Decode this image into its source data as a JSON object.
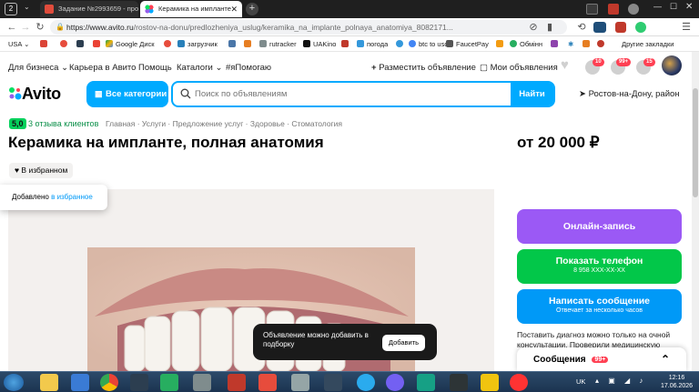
{
  "browser": {
    "tab_counter": "2",
    "tabs": [
      {
        "label": "Задание №2993659 - про",
        "active": false
      },
      {
        "label": "Керамика на импланте",
        "active": true
      }
    ],
    "url_host": "https://www.avito.ru",
    "url_path": "/rostov-na-donu/predlozheniya_uslug/keramika_na_implante_polnaya_anatomiya_8082171...",
    "bookmarks": [
      "USA",
      "Google Диск",
      "загрузчик",
      "rutracker",
      "UAKino",
      "погода",
      "btc to usd",
      "FaucetPay",
      "Обмінн"
    ],
    "other_bookmarks": "Другие закладки"
  },
  "topnav": {
    "business": "Для бизнеса",
    "career": "Карьера в Авито",
    "help": "Помощь",
    "catalogs": "Каталоги",
    "hashtag": "#яПомогаю",
    "post_ad": "Разместить объявление",
    "my_ads": "Мои объявления",
    "badges": [
      "10",
      "99+",
      "15"
    ]
  },
  "header": {
    "logo": "Avito",
    "all_categories": "Все категории",
    "search_placeholder": "Поиск по объявлениям",
    "find": "Найти",
    "location": "Ростов-на-Дону, район"
  },
  "listing": {
    "rating_value": "5,0",
    "rating_label": "3 отзыва клиентов",
    "breadcrumbs": [
      "Главная",
      "Услуги",
      "Предложение услуг",
      "Здоровье",
      "Стоматология"
    ],
    "title": "Керамика на импланте, полная анатомия",
    "price": "от 20 000 ₽",
    "favorite_button": "В избранном"
  },
  "toast_favorites": {
    "text": "Добавлено",
    "link": "в избранное"
  },
  "actions": {
    "online_booking": "Онлайн-запись",
    "show_phone": "Показать телефон",
    "phone_masked": "8 958 XXX-XX-XX",
    "write_message": "Написать сообщение",
    "reply_time": "Отвечает за несколько часов"
  },
  "description": "Поставить диагноз можно только на очной консультации. Проверили медицинскую лицензию ... объявлен",
  "toast_collection": {
    "text": "Объявление можно добавить в подборку",
    "button": "Добавить"
  },
  "messages": {
    "label": "Сообщения",
    "badge": "99+"
  },
  "taskbar": {
    "lang": "UK",
    "time": "12:16",
    "date": "17.06.2026"
  },
  "colors": {
    "avito_blue": "#00aaff",
    "booking_purple": "#9b59f5",
    "phone_green": "#02c749",
    "message_blue": "#0099f7",
    "rating_green": "#02d15c"
  }
}
